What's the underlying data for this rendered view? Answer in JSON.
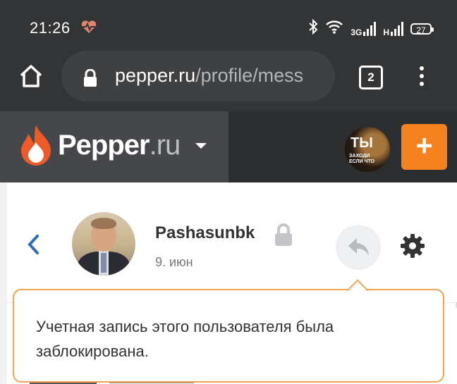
{
  "status_bar": {
    "time": "21:26",
    "health_icon": "heart-pulse-icon",
    "bluetooth_icon": "bluetooth-icon",
    "wifi_icon": "wifi-icon",
    "sim1_network": "3G",
    "sim2_network": "H",
    "battery": "27"
  },
  "browser": {
    "url_host": "pepper.ru",
    "url_path": "/profile/mess",
    "tab_count": "2"
  },
  "site_header": {
    "logo_text": "Pepper",
    "logo_tld": ".ru",
    "plus_label": "+",
    "accent_color": "#f5821f"
  },
  "profile": {
    "username": "Pashasunbk",
    "date": "9. июн"
  },
  "tooltip": {
    "message": "Учетная запись этого пользователя была заблокирована.",
    "border_color": "#f2a450"
  }
}
